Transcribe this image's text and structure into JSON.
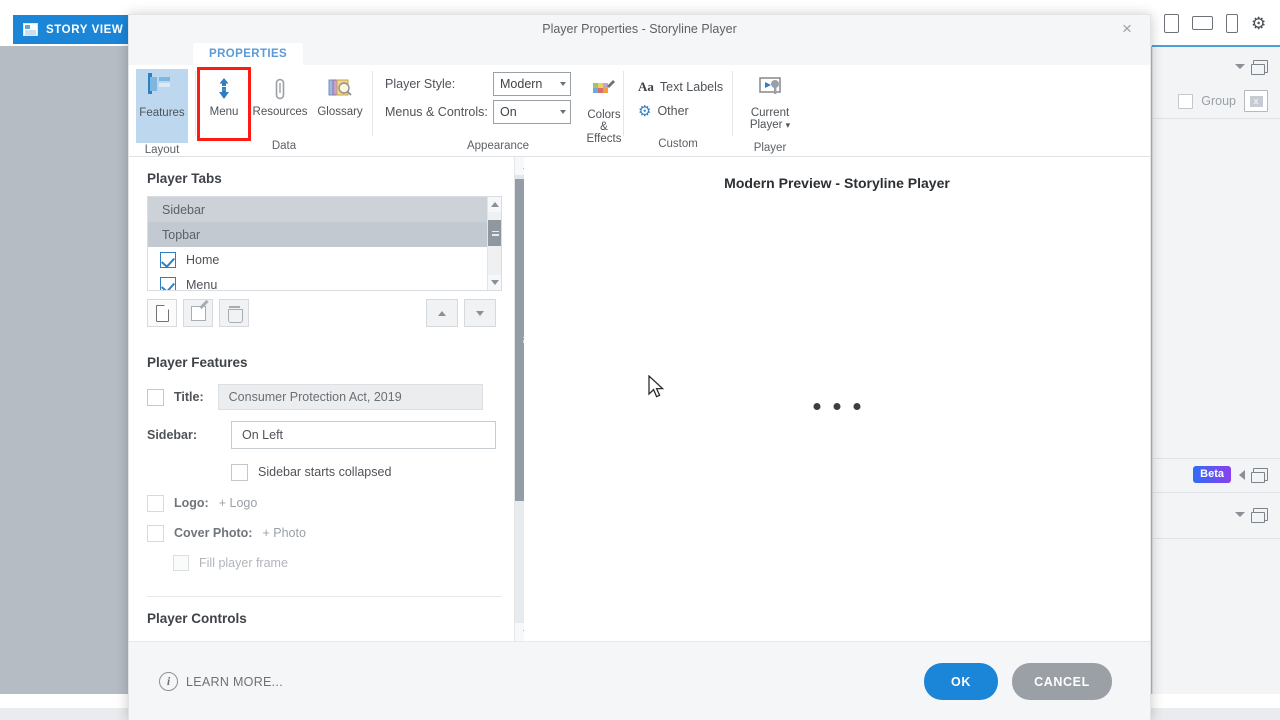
{
  "background": {
    "story_view_tab": "STORY VIEW",
    "group_label": "Group",
    "beta_badge": "Beta",
    "device_icons": [
      "tablet-portrait-icon",
      "tablet-landscape-icon",
      "phone-icon",
      "gear-icon"
    ]
  },
  "dialog": {
    "title": "Player Properties - Storyline Player",
    "close_label": "×"
  },
  "ribbon": {
    "tab": "PROPERTIES",
    "groups": [
      {
        "name": "Layout",
        "buttons": [
          {
            "label": "Features",
            "icon": "features-icon",
            "state": "active"
          }
        ]
      },
      {
        "name": "Data",
        "buttons": [
          {
            "label": "Menu",
            "icon": "menu-icon",
            "state": "highlighted"
          },
          {
            "label": "Resources",
            "icon": "paperclip-icon",
            "state": "normal"
          },
          {
            "label": "Glossary",
            "icon": "glossary-icon",
            "state": "normal"
          }
        ]
      },
      {
        "name": "Appearance",
        "fields": [
          {
            "label": "Player Style:",
            "value": "Modern"
          },
          {
            "label": "Menus & Controls:",
            "value": "On"
          }
        ],
        "buttons": [
          {
            "label": "Colors & Effects",
            "icon": "palette-icon"
          }
        ]
      },
      {
        "name": "Custom",
        "buttons": [
          {
            "label": "Text Labels",
            "icon": "text-labels-icon"
          },
          {
            "label": "Other",
            "icon": "gear-icon"
          }
        ]
      },
      {
        "name": "Player",
        "buttons": [
          {
            "label": "Current Player",
            "icon": "current-player-icon"
          }
        ]
      }
    ]
  },
  "player_tabs": {
    "heading": "Player Tabs",
    "rows": [
      {
        "label": "Sidebar",
        "type": "header",
        "selected": false
      },
      {
        "label": "Topbar",
        "type": "header",
        "selected": true
      },
      {
        "label": "Home",
        "type": "item",
        "checked": true
      },
      {
        "label": "Menu",
        "type": "item",
        "checked": true
      }
    ],
    "toolbar": {
      "new": "new-tab-button",
      "edit": "edit-tab-button",
      "delete": "delete-tab-button",
      "move_up": "move-up-button",
      "move_down": "move-down-button"
    }
  },
  "player_features": {
    "heading": "Player Features",
    "title_label": "Title:",
    "title_value": "Consumer Protection Act, 2019",
    "title_checked": false,
    "sidebar_label": "Sidebar:",
    "sidebar_value": "On Left",
    "sidebar_collapsed_label": "Sidebar starts collapsed",
    "sidebar_collapsed_checked": false,
    "logo_label": "Logo:",
    "logo_action": "+ Logo",
    "logo_checked": false,
    "cover_photo_label": "Cover Photo:",
    "cover_photo_action": "+ Photo",
    "cover_photo_checked": false,
    "fill_frame_label": "Fill player frame",
    "fill_frame_checked": false
  },
  "player_controls": {
    "heading": "Player Controls"
  },
  "preview": {
    "title": "Modern Preview - Storyline Player",
    "loading": "loading-dots"
  },
  "footer": {
    "learn_more": "LEARN MORE...",
    "ok": "OK",
    "cancel": "CANCEL"
  },
  "colors": {
    "accent_blue": "#1b86d8",
    "highlight_red": "#fd1c14",
    "tab_text_blue": "#5b9bd5",
    "cancel_gray": "#9aa0a6"
  }
}
